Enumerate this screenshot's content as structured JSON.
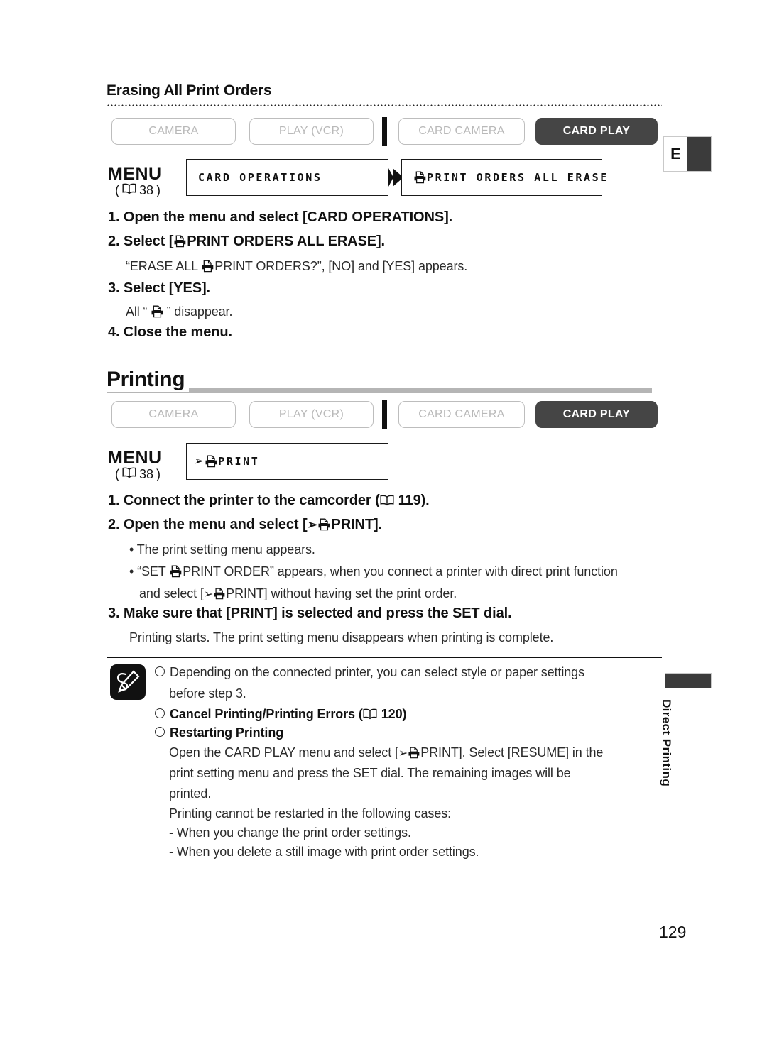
{
  "page": {
    "number": "129",
    "language_tab": "E",
    "side_tab_label": "Direct Printing"
  },
  "section_erase": {
    "heading": "Erasing All Print Orders",
    "modes": [
      {
        "label": "CAMERA",
        "active": false
      },
      {
        "label": "PLAY (VCR)",
        "active": false
      },
      {
        "label": "CARD CAMERA",
        "active": false
      },
      {
        "label": "CARD PLAY",
        "active": true
      }
    ],
    "menu": {
      "label": "MENU",
      "ref_prefix": "(",
      "ref_page": "38",
      "ref_suffix": ")",
      "box1": "CARD OPERATIONS",
      "box2": "PRINT ORDERS ALL ERASE"
    },
    "steps": [
      {
        "text": "1. Open the menu and select [CARD OPERATIONS]."
      },
      {
        "text_before": "2. Select [",
        "icon": "printer-icon",
        "text_after": "PRINT ORDERS ALL ERASE]."
      },
      {
        "note_before": "“ERASE ALL ",
        "icon": "printer-icon",
        "note_after": "PRINT ORDERS?”, [NO] and [YES] appears."
      },
      {
        "text": "3. Select [YES]."
      },
      {
        "note_before": "All “",
        "icon": "printer-icon",
        "note_after": "” disappear."
      },
      {
        "text": "4. Close the menu."
      }
    ]
  },
  "section_printing": {
    "heading": "Printing",
    "modes": [
      {
        "label": "CAMERA",
        "active": false
      },
      {
        "label": "PLAY (VCR)",
        "active": false
      },
      {
        "label": "CARD CAMERA",
        "active": false
      },
      {
        "label": "CARD PLAY",
        "active": true
      }
    ],
    "menu": {
      "label": "MENU",
      "ref_prefix": "(",
      "ref_page": "38",
      "ref_suffix": ")",
      "box1": "PRINT"
    },
    "steps": {
      "s1_a": "1. Connect the printer to the camcorder (",
      "s1_page": "119",
      "s1_b": ").",
      "s2_a": "2. Open the menu and select [",
      "s2_b": "PRINT].",
      "b1": "• The print setting menu appears.",
      "b2_a": "• “SET ",
      "b2_b": "PRINT ORDER” appears, when you connect a printer with direct print function",
      "b2_c": "and select [",
      "b2_d": "PRINT] without having set the print order.",
      "s3": "3. Make sure that [PRINT] is selected and press the SET dial.",
      "s3_note": "Printing starts. The print setting menu disappears when printing is complete."
    }
  },
  "memo": {
    "icon": "memo-pencil-icon",
    "items": [
      {
        "bold": false,
        "line1": "Depending on the connected printer, you can select style or paper settings",
        "line2": "before step 3."
      },
      {
        "bold": true,
        "line1_a": "Cancel Printing/Printing Errors (",
        "page": "120",
        "line1_b": ")"
      },
      {
        "bold": true,
        "line1": "Restarting Printing"
      }
    ],
    "body": {
      "l1_a": "Open the CARD PLAY menu and select [",
      "l1_b": "PRINT]. Select [RESUME] in the",
      "l2": "print setting menu and press the SET dial. The remaining images will be",
      "l3": "printed.",
      "l4": "Printing cannot be restarted in the following cases:",
      "l5": "-   When you change the print order settings.",
      "l6": "-   When you delete a still image with print order settings."
    }
  },
  "colors": {
    "active_mode_bg": "#454545",
    "inactive_border": "#bdbdbd",
    "inactive_text": "#b9b9b9",
    "rule_grey": "#b5b5b5",
    "text": "#1a1a1a"
  }
}
